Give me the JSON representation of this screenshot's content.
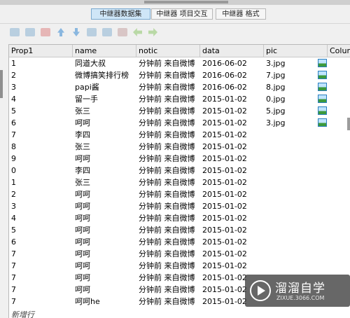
{
  "tabs": [
    {
      "label": "中继器数据集",
      "active": true
    },
    {
      "label": "中继器 项目交互",
      "active": false
    },
    {
      "label": "中继器 格式",
      "active": false
    }
  ],
  "toolbar_icons": [
    "insert-row-icon",
    "insert-row-after-icon",
    "delete-row-icon",
    "move-up-icon",
    "move-down-icon",
    "insert-column-icon",
    "insert-column-after-icon",
    "delete-column-icon",
    "move-left-icon",
    "move-right-icon"
  ],
  "columns": [
    "Prop1",
    "name",
    "notic",
    "data",
    "pic",
    "Colum"
  ],
  "rows": [
    {
      "prop1": "1",
      "name": "同道大叔",
      "notic": "分钟前 来自微博",
      "data": "2016-06-02",
      "pic": "3.jpg",
      "has_img": true
    },
    {
      "prop1": "2",
      "name": "微博搞笑排行榜",
      "notic": "分钟前 来自微博",
      "data": "2016-06-02",
      "pic": "7.jpg",
      "has_img": true
    },
    {
      "prop1": "3",
      "name": "papi酱",
      "notic": "分钟前 来自微博",
      "data": "2016-06-02",
      "pic": "8.jpg",
      "has_img": true
    },
    {
      "prop1": "4",
      "name": "留一手",
      "notic": "分钟前 来自微博",
      "data": "2015-01-02",
      "pic": "0.jpg",
      "has_img": true
    },
    {
      "prop1": "5",
      "name": "张三",
      "notic": "分钟前 来自微博",
      "data": "2015-01-02",
      "pic": "5.jpg",
      "has_img": true
    },
    {
      "prop1": "6",
      "name": "呵呵",
      "notic": "分钟前 来自微博",
      "data": "2015-01-02",
      "pic": "3.jpg",
      "has_img": true
    },
    {
      "prop1": "7",
      "name": "李四",
      "notic": "分钟前 来自微博",
      "data": "2015-01-02",
      "pic": "",
      "has_img": false
    },
    {
      "prop1": "8",
      "name": "张三",
      "notic": "分钟前 来自微博",
      "data": "2015-01-02",
      "pic": "",
      "has_img": false
    },
    {
      "prop1": "9",
      "name": "呵呵",
      "notic": "分钟前 来自微博",
      "data": "2015-01-02",
      "pic": "",
      "has_img": false
    },
    {
      "prop1": "0",
      "name": "李四",
      "notic": "分钟前 来自微博",
      "data": "2015-01-02",
      "pic": "",
      "has_img": false
    },
    {
      "prop1": "1",
      "name": "张三",
      "notic": "分钟前 来自微博",
      "data": "2015-01-02",
      "pic": "",
      "has_img": false
    },
    {
      "prop1": "2",
      "name": "呵呵",
      "notic": "分钟前 来自微博",
      "data": "2015-01-02",
      "pic": "",
      "has_img": false
    },
    {
      "prop1": "3",
      "name": "呵呵",
      "notic": "分钟前 来自微博",
      "data": "2015-01-02",
      "pic": "",
      "has_img": false
    },
    {
      "prop1": "4",
      "name": "呵呵",
      "notic": "分钟前 来自微博",
      "data": "2015-01-02",
      "pic": "",
      "has_img": false
    },
    {
      "prop1": "5",
      "name": "呵呵",
      "notic": "分钟前 来自微博",
      "data": "2015-01-02",
      "pic": "",
      "has_img": false
    },
    {
      "prop1": "6",
      "name": "呵呵",
      "notic": "分钟前 来自微博",
      "data": "2015-01-02",
      "pic": "",
      "has_img": false
    },
    {
      "prop1": "7",
      "name": "呵呵",
      "notic": "分钟前 来自微博",
      "data": "2015-01-02",
      "pic": "",
      "has_img": false
    },
    {
      "prop1": "7",
      "name": "呵呵",
      "notic": "分钟前 来自微博",
      "data": "2015-01-02",
      "pic": "",
      "has_img": false
    },
    {
      "prop1": "7",
      "name": "呵呵",
      "notic": "分钟前 来自微博",
      "data": "2015-01-02",
      "pic": "",
      "has_img": false
    },
    {
      "prop1": "7",
      "name": "呵呵",
      "notic": "分钟前 来自微博",
      "data": "2015-01-02",
      "pic": "",
      "has_img": false
    },
    {
      "prop1": "7",
      "name": "呵呵he",
      "notic": "分钟前 来自微博",
      "data": "2015-01-02",
      "pic": "",
      "has_img": false
    }
  ],
  "new_row_label": "新增行",
  "watermark": {
    "title": "溜溜自学",
    "subtitle": "ZIXUE.3066.COM"
  }
}
